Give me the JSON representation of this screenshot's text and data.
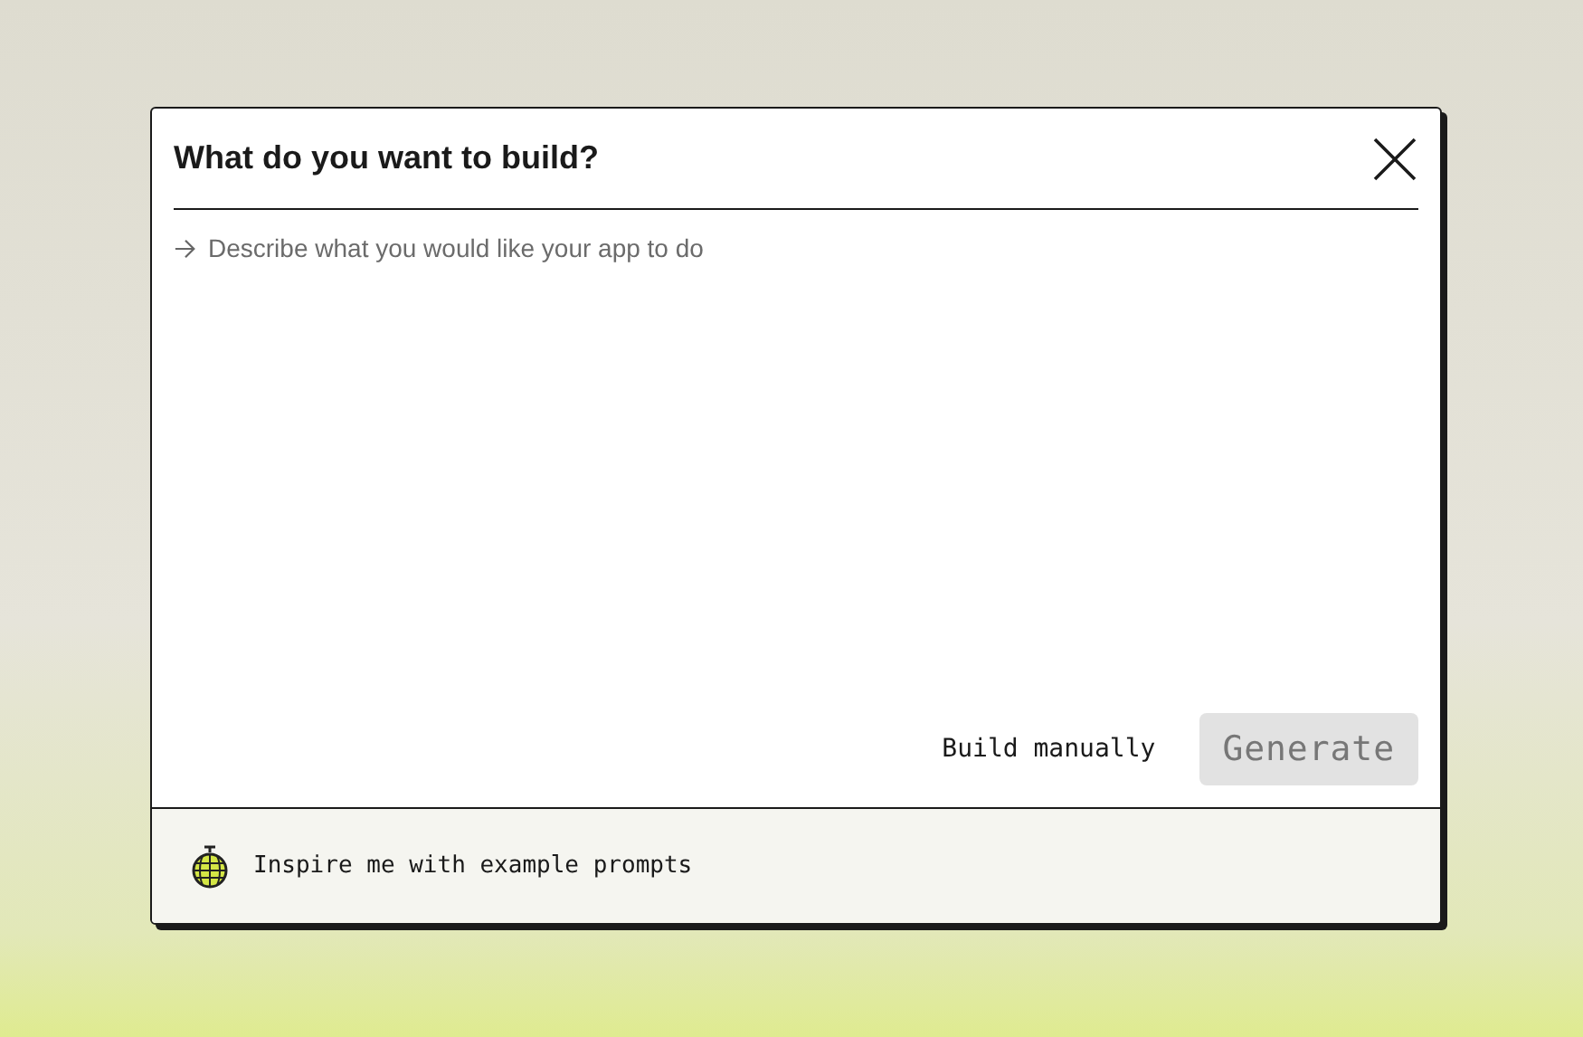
{
  "dialog": {
    "title": "What do you want to build?"
  },
  "prompt": {
    "placeholder": "Describe what you would like your app to do"
  },
  "actions": [
    {
      "label": "Build manually",
      "kind": "text",
      "disabled": false
    },
    {
      "label": "Generate",
      "kind": "filled",
      "disabled": true
    }
  ],
  "footer": {
    "label": "Inspire me with example prompts"
  }
}
